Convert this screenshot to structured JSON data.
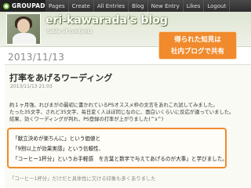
{
  "topbar": {
    "brand": "GROUPAD",
    "nav": [
      "Pages",
      "Create",
      "All Entries",
      "Blog",
      "New Entry",
      "Likes",
      "Logout"
    ]
  },
  "header": {
    "blog_title": "eri-kawarada's blog",
    "subtitle": "table of contents"
  },
  "callout": {
    "line1": "得られた知見は",
    "line2": "社内ブログで共有"
  },
  "date": "2013/11/13",
  "entry": {
    "title": "打率をあげるワーディング",
    "time": "2013/11/13 21:03",
    "body": [
      "約１ヶ月強、れびまがの最初に書かれているPSオススメ枠の文言をあれこれ試してみました。",
      "たった35文字、されど35文字、毎日変く人ほぼ同じなのに、面白いくらいに反応が違っていました。",
      "結果、効くワーディングが判れ、PS登録の打率が上がりました(^з^)"
    ],
    "quote": [
      "「献立決めが楽ちんに」という価値と",
      "「9割以上が効果実感」という信頼性、",
      "「コーヒー1杯分」というお手軽感　を言葉と数字で与えてあげるのが大事」と学びました。"
    ],
    "trailing": "「コーヒー1杯分」だけだと具体性に欠ける印象も多くありました"
  },
  "colors": {
    "accent": "#f08a2c",
    "topbar": "#333333",
    "header_bg": "#e4eadb"
  }
}
